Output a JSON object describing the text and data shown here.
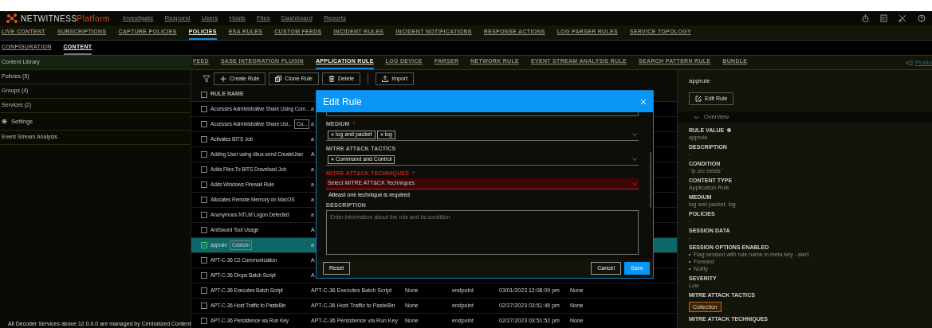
{
  "top_bar": {
    "brand": "NETWITNESS",
    "brand_suffix": "Platform",
    "menu": [
      "Investigate",
      "Respond",
      "Users",
      "Hosts",
      "Files",
      "Dashboard",
      "Reports"
    ]
  },
  "admin_tabs": [
    {
      "label": "LIVE CONTENT",
      "selected": false
    },
    {
      "label": "SUBSCRIPTIONS",
      "selected": false
    },
    {
      "label": "CAPTURE POLICIES",
      "selected": false
    },
    {
      "label": "POLICIES",
      "selected": true
    },
    {
      "label": "ESA RULES",
      "selected": false
    },
    {
      "label": "CUSTOM FEEDS",
      "selected": false
    },
    {
      "label": "INCIDENT RULES",
      "selected": false
    },
    {
      "label": "INCIDENT NOTIFICATIONS",
      "selected": false
    },
    {
      "label": "RESPONSE ACTIONS",
      "selected": false
    },
    {
      "label": "LOG PARSER RULES",
      "selected": false
    },
    {
      "label": "SERVICE TOPOLOGY",
      "selected": false
    }
  ],
  "sub_tabs": [
    {
      "label": "CONFIGURATION",
      "selected": false
    },
    {
      "label": "CONTENT",
      "selected": true
    }
  ],
  "sidebar": {
    "items": [
      {
        "label": "Content Library",
        "kind": "item",
        "selected": true
      },
      {
        "label": "Policies (5)",
        "kind": "item",
        "selected": false
      },
      {
        "label": "Groups (4)",
        "kind": "item",
        "selected": false
      },
      {
        "label": "Services (2)",
        "kind": "item",
        "selected": false
      },
      {
        "label": "Settings",
        "kind": "section",
        "selected": false
      },
      {
        "label": "Event Stream Analysis",
        "kind": "item",
        "selected": false
      }
    ],
    "footer": "All Decoder Services above 12.0.0.0 are managed by Centralized Content"
  },
  "content_tabs": [
    {
      "label": "FEED",
      "selected": false
    },
    {
      "label": "SASE INTEGRATION PLUGIN",
      "selected": false
    },
    {
      "label": "APPLICATION RULE",
      "selected": true
    },
    {
      "label": "LOG DEVICE",
      "selected": false
    },
    {
      "label": "PARSER",
      "selected": false
    },
    {
      "label": "NETWORK RULE",
      "selected": false
    },
    {
      "label": "EVENT STREAM ANALYSIS RULE",
      "selected": false
    },
    {
      "label": "SEARCH PATTERN RULE",
      "selected": false
    },
    {
      "label": "BUNDLE",
      "selected": false
    }
  ],
  "side_link": "Produ",
  "toolbar": [
    {
      "kind": "create",
      "label": "Create Rule"
    },
    {
      "kind": "clone",
      "label": "Clone Rule"
    },
    {
      "kind": "delete",
      "label": "Delete"
    },
    {
      "kind": "import",
      "label": "Import"
    }
  ],
  "table": {
    "columns": [
      "RULE NAME"
    ],
    "select_all_checked": false,
    "rows": [
      {
        "cells": [
          "Accesses Administrative Share Using Com...",
          "a"
        ],
        "selected": false,
        "checked": false
      },
      {
        "cells": [
          "Accesses Administrative Share Usi...",
          "a"
        ],
        "badge": "Cu...",
        "selected": false,
        "checked": false
      },
      {
        "cells": [
          "Activates BITS Job",
          "a"
        ],
        "selected": false,
        "checked": false
      },
      {
        "cells": [
          "Adding User using dbus-send CreateUser",
          "A"
        ],
        "selected": false,
        "checked": false
      },
      {
        "cells": [
          "Adds Files To BITS Download Job",
          "a"
        ],
        "selected": false,
        "checked": false
      },
      {
        "cells": [
          "Adds Windows Firewall Rule",
          "a"
        ],
        "selected": false,
        "checked": false
      },
      {
        "cells": [
          "Allocates Remote Memory on MacOS",
          "a"
        ],
        "selected": false,
        "checked": false
      },
      {
        "cells": [
          "Anonymous NTLM Logon Detected",
          "a"
        ],
        "selected": false,
        "checked": false
      },
      {
        "cells": [
          "AntSword Tool Usage",
          "A"
        ],
        "selected": false,
        "checked": false
      },
      {
        "cells": [
          "apprule",
          "a"
        ],
        "badge": "Custom",
        "selected": true,
        "checked": true
      },
      {
        "cells": [
          "APT-C-36 C2 Communication",
          "A"
        ],
        "selected": false,
        "checked": false
      },
      {
        "cells": [
          "APT-C-36 Drops Batch Script",
          "A"
        ],
        "selected": false,
        "checked": false
      },
      {
        "cells": [
          "APT-C-36 Executes Batch Script",
          "APT-C-36 Executes Batch Script",
          "None",
          "endpoint",
          "03/01/2023 12:08:09 pm",
          "None"
        ],
        "selected": false,
        "checked": false
      },
      {
        "cells": [
          "APT-C-36 Host Traffic to PasteBin",
          "APT-C-36 Host Traffic to PasteBin",
          "None",
          "endpoint",
          "02/27/2023 03:51:46 pm",
          "None"
        ],
        "selected": false,
        "checked": false
      },
      {
        "cells": [
          "APT-C-36 Persistence via Run Key",
          "APT-C-36 Persistence via Run Key",
          "None",
          "endpoint",
          "02/27/2023 03:51:52 pm",
          "None"
        ],
        "selected": false,
        "checked": false
      }
    ]
  },
  "modal": {
    "title": "Edit Rule",
    "fields": [
      {
        "kind": "textarea_end"
      },
      {
        "kind": "tags",
        "label": "MEDIUM",
        "required_mark": "*",
        "tags": [
          "log and packet",
          "log"
        ]
      },
      {
        "kind": "tags",
        "label": "MITRE ATT&CK TACTICS",
        "tags": [
          "Command and Control"
        ]
      },
      {
        "kind": "select",
        "label": "MITRE ATT&CK TECHNIQUES",
        "required_mark": "*",
        "placeholder": "Select MITRE ATT&CK Techniques",
        "error": "Atleast one technique is required"
      },
      {
        "kind": "textarea",
        "label": "DESCRIPTION",
        "placeholder": "Enter information about the rule and its condition"
      }
    ],
    "buttons": [
      {
        "kind": "reset",
        "label": "Reset"
      },
      {
        "kind": "cancel",
        "label": "Cancel"
      },
      {
        "kind": "save",
        "label": "Save"
      }
    ]
  },
  "detail": {
    "title": "apprule",
    "edit_button": "Edit Rule",
    "section": {
      "title": "Overview",
      "expanded": true
    },
    "fields": [
      {
        "label": "RULE VALUE",
        "info": true,
        "value": "apprule"
      },
      {
        "label": "DESCRIPTION",
        "value": "-"
      },
      {
        "label": "CONDITION",
        "value": "' ip.src exists '"
      },
      {
        "label": "CONTENT TYPE",
        "value": "Application Rule"
      },
      {
        "label": "MEDIUM",
        "value": "log and packet, log"
      },
      {
        "label": "POLICIES",
        "value": "-"
      },
      {
        "label": "SESSION DATA",
        "value": "-"
      },
      {
        "label": "SESSION OPTIONS ENABLED",
        "items": [
          "Flag session with rule name in meta key - alert",
          "Forward",
          "Notify"
        ]
      },
      {
        "label": "SEVERITY",
        "value": "Low"
      },
      {
        "label": "MITRE ATTACK TACTICS",
        "badges": [
          "Collection"
        ]
      },
      {
        "label": "MITRE ATTACK TECHNIQUES"
      }
    ]
  }
}
